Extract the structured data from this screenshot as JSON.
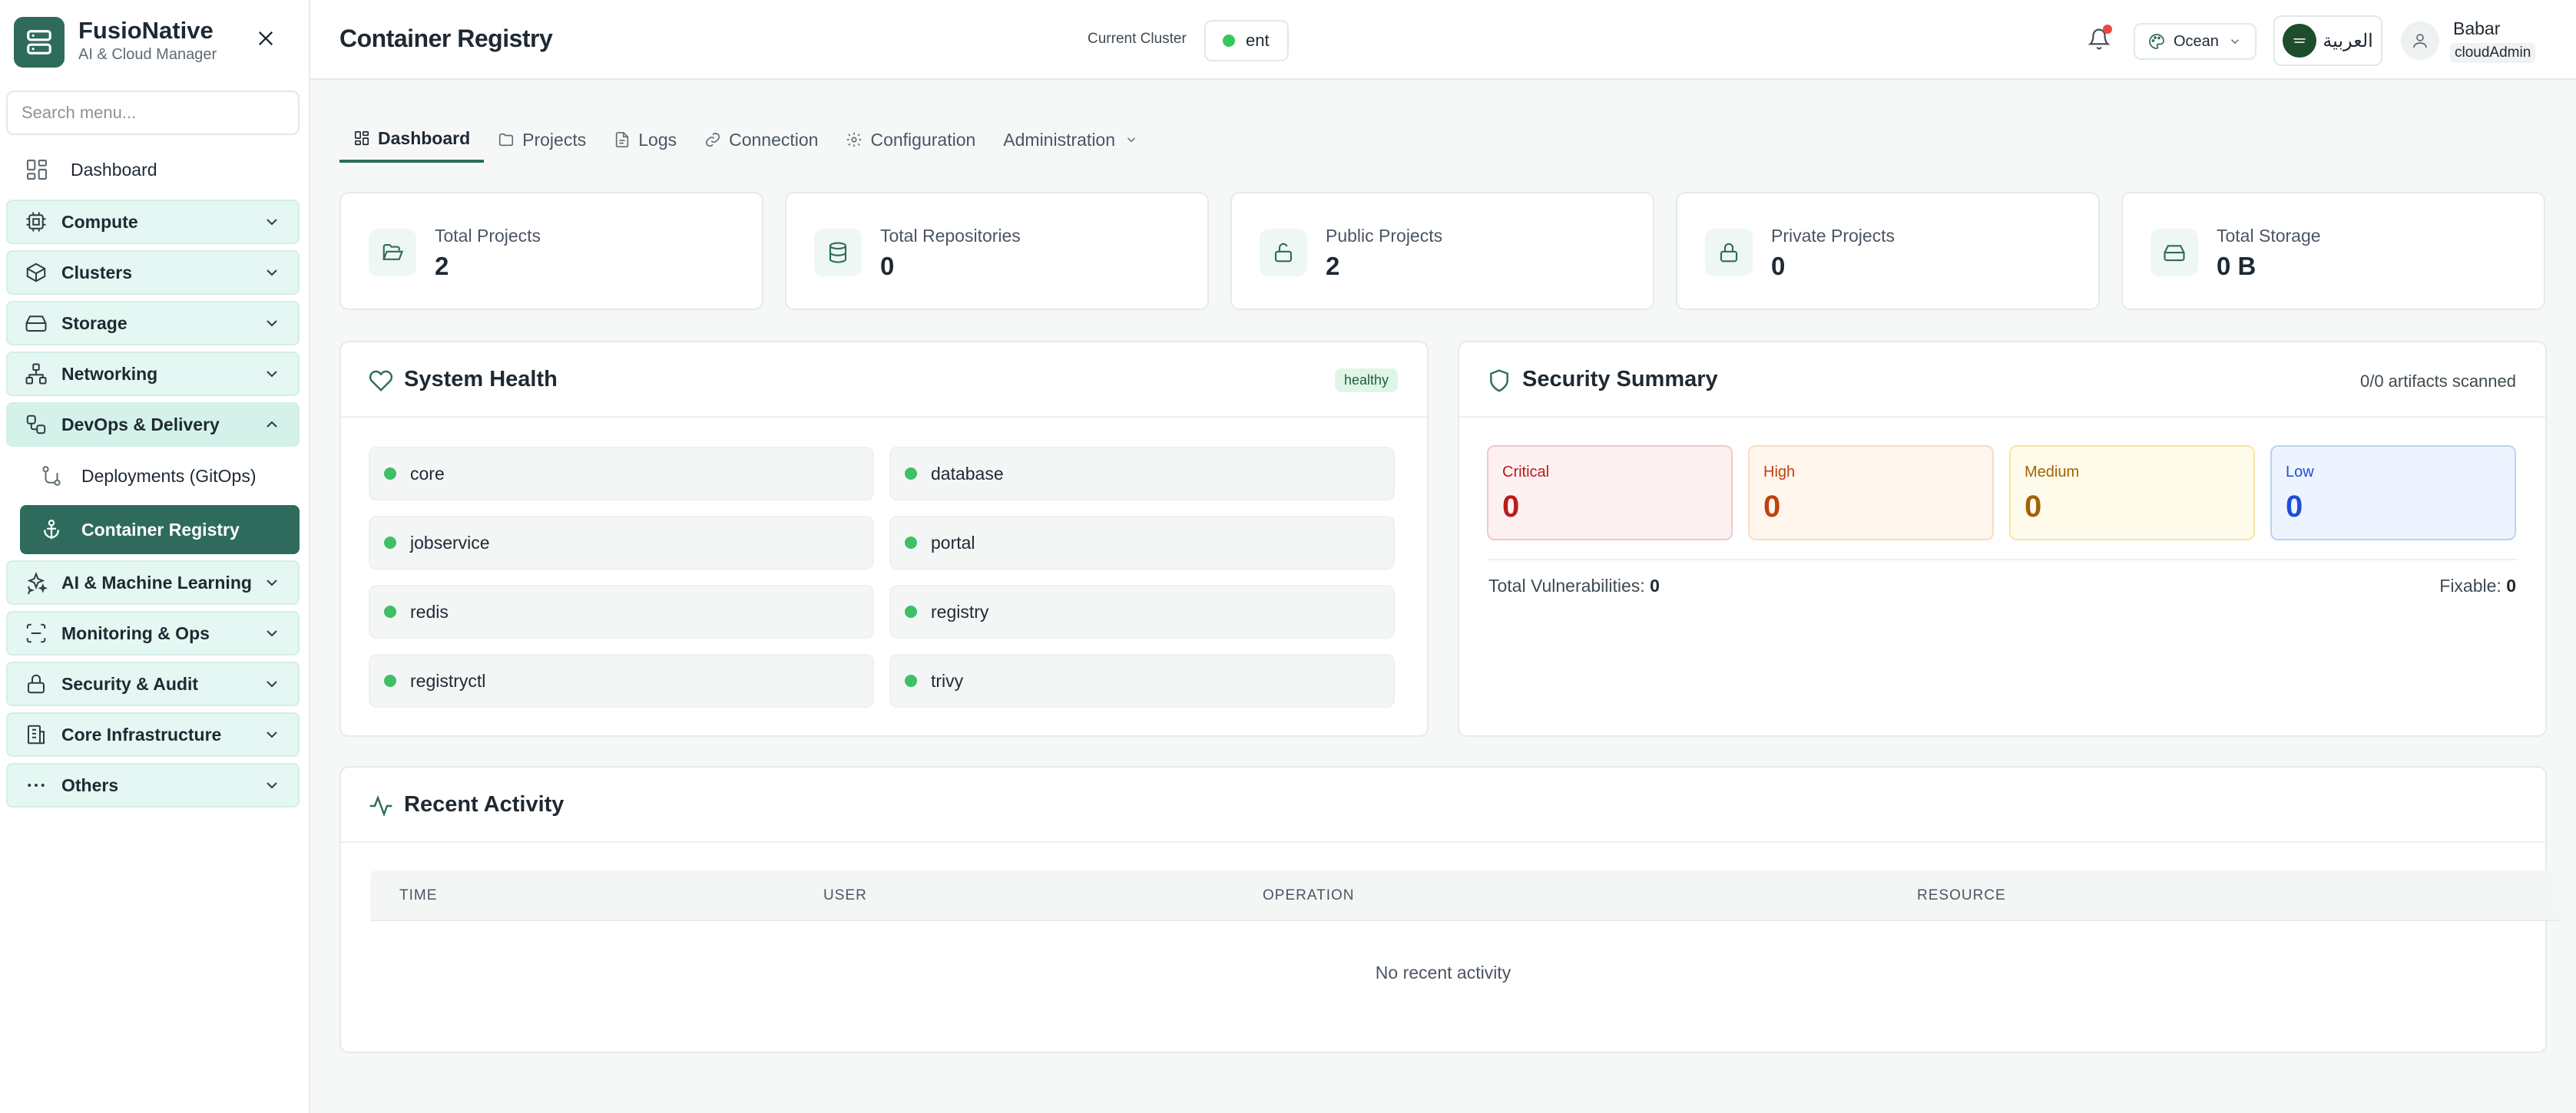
{
  "brand": {
    "name": "FusioNative",
    "subtitle": "AI & Cloud Manager"
  },
  "sidebar": {
    "search_placeholder": "Search menu...",
    "dashboard": "Dashboard",
    "groups": [
      {
        "label": "Compute",
        "icon": "cpu-icon"
      },
      {
        "label": "Clusters",
        "icon": "box-icon"
      },
      {
        "label": "Storage",
        "icon": "hard-drive-icon"
      },
      {
        "label": "Networking",
        "icon": "network-icon"
      },
      {
        "label": "DevOps & Delivery",
        "icon": "workflow-icon",
        "expanded": true,
        "children": [
          {
            "label": "Deployments (GitOps)",
            "icon": "git-branch-icon"
          },
          {
            "label": "Container Registry",
            "icon": "anchor-icon",
            "active": true
          }
        ]
      },
      {
        "label": "AI & Machine Learning",
        "icon": "sparkles-icon"
      },
      {
        "label": "Monitoring & Ops",
        "icon": "scan-icon"
      },
      {
        "label": "Security & Audit",
        "icon": "lock-icon"
      },
      {
        "label": "Core Infrastructure",
        "icon": "building-icon"
      },
      {
        "label": "Others",
        "icon": "more-icon"
      }
    ]
  },
  "header": {
    "title": "Container Registry",
    "cluster_label": "Current Cluster",
    "cluster_value": "ent",
    "theme": "Ocean",
    "language": "العربية",
    "user_name": "Babar",
    "user_role": "cloudAdmin"
  },
  "tabs": [
    {
      "label": "Dashboard",
      "icon": "layout-grid-icon",
      "active": true
    },
    {
      "label": "Projects",
      "icon": "folder-icon"
    },
    {
      "label": "Logs",
      "icon": "file-text-icon"
    },
    {
      "label": "Connection",
      "icon": "link-icon"
    },
    {
      "label": "Configuration",
      "icon": "settings-icon"
    },
    {
      "label": "Administration",
      "icon": "",
      "dropdown": true
    }
  ],
  "stats": [
    {
      "label": "Total Projects",
      "value": "2",
      "icon": "folder-open-icon"
    },
    {
      "label": "Total Repositories",
      "value": "0",
      "icon": "database-icon"
    },
    {
      "label": "Public Projects",
      "value": "2",
      "icon": "unlock-icon"
    },
    {
      "label": "Private Projects",
      "value": "0",
      "icon": "lock-icon"
    },
    {
      "label": "Total Storage",
      "value": "0 B",
      "icon": "hard-drive-icon"
    }
  ],
  "health": {
    "title": "System Health",
    "status": "healthy",
    "services": [
      "core",
      "database",
      "jobservice",
      "portal",
      "redis",
      "registry",
      "registryctl",
      "trivy"
    ]
  },
  "security": {
    "title": "Security Summary",
    "scanned": "0/0 artifacts scanned",
    "levels": [
      {
        "label": "Critical",
        "value": "0",
        "color": "#c81e1e",
        "bg": "#fdf0f0",
        "border": "#f5c8c8"
      },
      {
        "label": "High",
        "value": "0",
        "color": "#c2410c",
        "bg": "#fff6ee",
        "border": "#fbdcc0"
      },
      {
        "label": "Medium",
        "value": "0",
        "color": "#a16207",
        "bg": "#fffbeb",
        "border": "#f6e7a8"
      },
      {
        "label": "Low",
        "value": "0",
        "color": "#1d4ed8",
        "bg": "#eef4ff",
        "border": "#bfd3f5"
      }
    ],
    "total_label": "Total Vulnerabilities:",
    "total_value": "0",
    "fixable_label": "Fixable:",
    "fixable_value": "0"
  },
  "activity": {
    "title": "Recent Activity",
    "columns": [
      "TIME",
      "USER",
      "OPERATION",
      "RESOURCE"
    ],
    "empty": "No recent activity"
  },
  "colors": {
    "brand": "#2e6b5c",
    "accent_bg": "#e5f7f2",
    "healthy_dot": "#3fbf66",
    "notification": "#ef4444"
  }
}
